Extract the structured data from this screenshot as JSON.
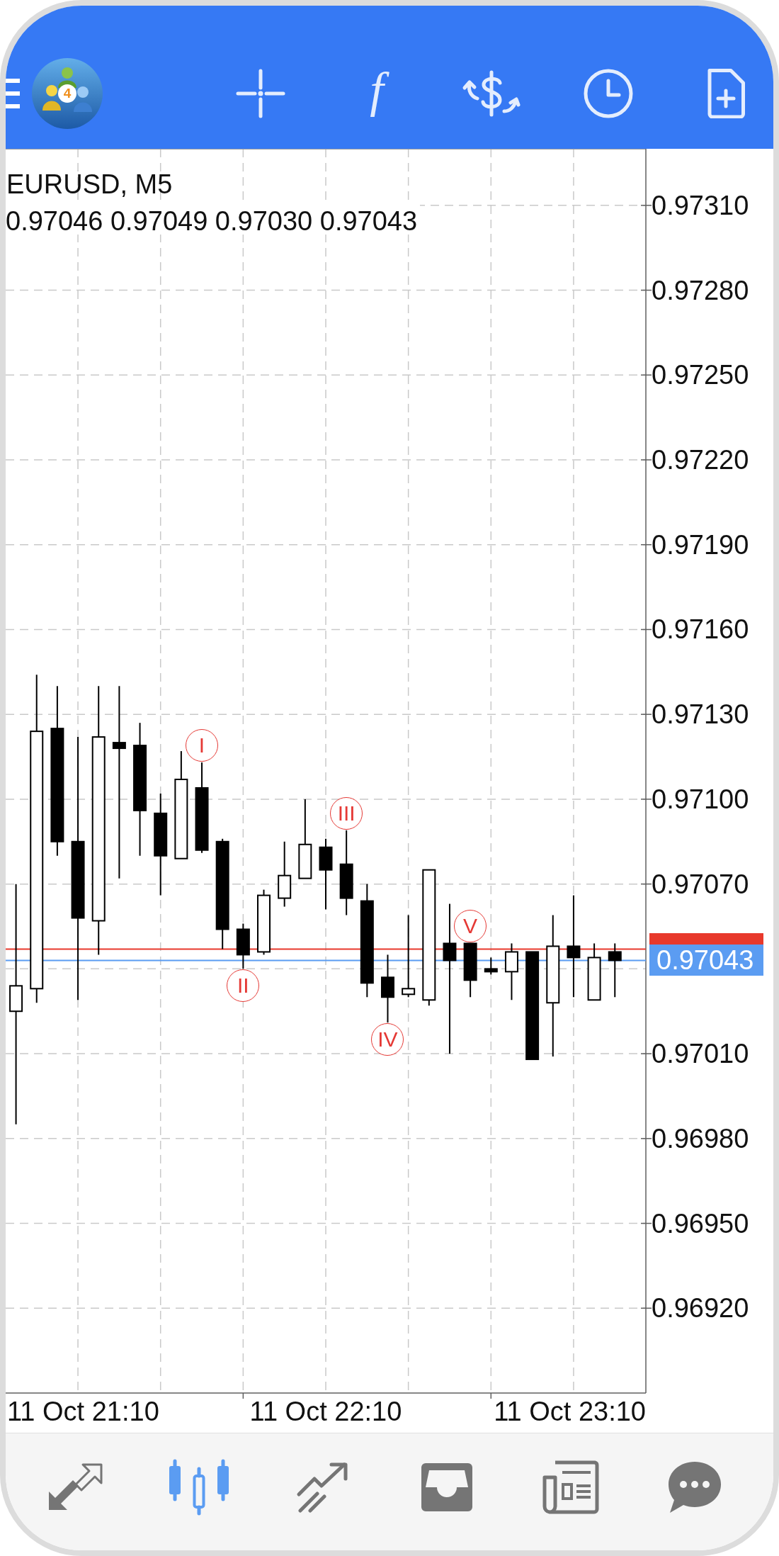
{
  "top_bar": {
    "logo_badge": "4",
    "toolbar": [
      {
        "kind": "crosshair"
      },
      {
        "kind": "function",
        "glyph": "f"
      },
      {
        "kind": "exchange"
      },
      {
        "kind": "clock"
      },
      {
        "kind": "document"
      }
    ]
  },
  "chart": {
    "ohlc": "0.97046 0.97049 0.97030 0.97043",
    "chart_data": {
      "type": "candlestick",
      "title": "EURUSD, M5",
      "grid": true,
      "categories": [
        null,
        null,
        null,
        "11 Oct 21:10",
        null,
        null,
        null,
        null,
        null,
        null,
        null,
        null,
        null,
        null,
        null,
        "11 Oct 22:10",
        null,
        null,
        null,
        null,
        null,
        null,
        null,
        null,
        null,
        null,
        null,
        "11 Oct 23:10",
        null,
        null,
        null
      ],
      "ohlc": [
        [
          0.97025,
          0.9707,
          0.96985,
          0.97034
        ],
        [
          0.97033,
          0.97144,
          0.97028,
          0.97124
        ],
        [
          0.97125,
          0.9714,
          0.9708,
          0.97085
        ],
        [
          0.97085,
          0.97122,
          0.97029,
          0.97058
        ],
        [
          0.97057,
          0.9714,
          0.97045,
          0.97122
        ],
        [
          0.9712,
          0.9714,
          0.97072,
          0.97118
        ],
        [
          0.97119,
          0.97127,
          0.9708,
          0.97096
        ],
        [
          0.97095,
          0.97102,
          0.97066,
          0.9708
        ],
        [
          0.97079,
          0.97117,
          0.97079,
          0.97107
        ],
        [
          0.97104,
          0.97113,
          0.97081,
          0.97082
        ],
        [
          0.97085,
          0.97086,
          0.97047,
          0.97054
        ],
        [
          0.97054,
          0.97056,
          0.9704,
          0.97045
        ],
        [
          0.97046,
          0.97068,
          0.97045,
          0.97066
        ],
        [
          0.97065,
          0.97085,
          0.97062,
          0.97073
        ],
        [
          0.97072,
          0.971,
          0.97072,
          0.97084
        ],
        [
          0.97083,
          0.97086,
          0.97061,
          0.97075
        ],
        [
          0.97077,
          0.97089,
          0.97059,
          0.97065
        ],
        [
          0.97064,
          0.9707,
          0.9703,
          0.97035
        ],
        [
          0.97037,
          0.97045,
          0.97021,
          0.9703
        ],
        [
          0.97031,
          0.97059,
          0.9703,
          0.97033
        ],
        [
          0.97029,
          0.97075,
          0.97027,
          0.97075
        ],
        [
          0.97049,
          0.97063,
          0.9701,
          0.97043
        ],
        [
          0.97049,
          0.97049,
          0.9703,
          0.97036
        ],
        [
          0.9704,
          0.97044,
          0.97038,
          0.97039
        ],
        [
          0.97039,
          0.97049,
          0.97029,
          0.97046
        ],
        [
          0.97046,
          0.97046,
          0.97008,
          0.97008
        ],
        [
          0.97028,
          0.97059,
          0.97009,
          0.97048
        ],
        [
          0.97048,
          0.97066,
          0.9703,
          0.97044
        ],
        [
          0.97029,
          0.97049,
          0.97029,
          0.97044
        ],
        [
          0.97046,
          0.97049,
          0.9703,
          0.97043
        ],
        null
      ],
      "ylim": [
        0.9689,
        0.9733
      ],
      "yticks": [
        {
          "value": 0.9731,
          "label": "0.97310"
        },
        {
          "value": 0.9728,
          "label": "0.97280"
        },
        {
          "value": 0.9725,
          "label": "0.97250"
        },
        {
          "value": 0.9722,
          "label": "0.97220"
        },
        {
          "value": 0.9719,
          "label": "0.97190"
        },
        {
          "value": 0.9716,
          "label": "0.97160"
        },
        {
          "value": 0.9713,
          "label": "0.97130"
        },
        {
          "value": 0.971,
          "label": "0.97100"
        },
        {
          "value": 0.9707,
          "label": "0.97070"
        },
        {
          "value": 0.9701,
          "label": "0.97010"
        },
        {
          "value": 0.9698,
          "label": "0.96980"
        },
        {
          "value": 0.9695,
          "label": "0.96950"
        },
        {
          "value": 0.9692,
          "label": "0.96920"
        }
      ],
      "annotations": [
        "I",
        "II",
        "III",
        "IV",
        "V"
      ],
      "ref_lines": [
        {
          "axis": "y",
          "value": 0.97047,
          "color": "#e8392c"
        },
        {
          "axis": "y",
          "value": 0.97043,
          "label": "0.97043",
          "color": "#5b9cf2"
        }
      ]
    }
  },
  "tabs": [
    {
      "kind": "quotes",
      "selected": false
    },
    {
      "kind": "chart",
      "selected": true
    },
    {
      "kind": "trade",
      "selected": false
    },
    {
      "kind": "history",
      "selected": false
    },
    {
      "kind": "news",
      "selected": false
    },
    {
      "kind": "chat",
      "selected": false
    }
  ]
}
